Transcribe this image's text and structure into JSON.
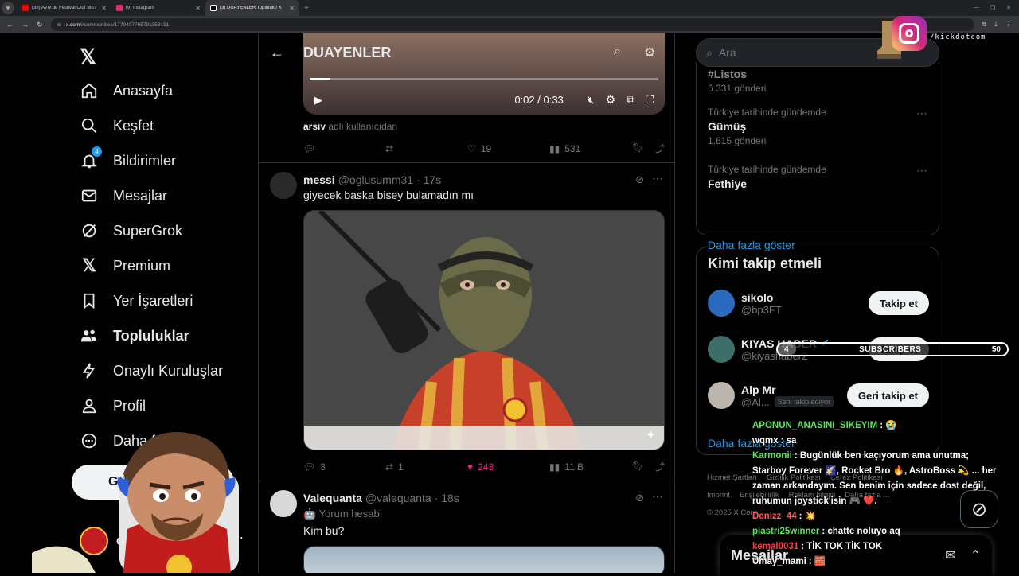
{
  "browser": {
    "tabs": [
      {
        "label": "(38) AVM'de Festival Olur Mu?",
        "color": "#ff0000"
      },
      {
        "label": "(9) Instagram",
        "color": "#e1306c"
      },
      {
        "label": "(3) DUAYENLER Topluluk / X",
        "color": "#ffffff"
      }
    ],
    "url_host": "x.com",
    "url_path": "/i/communities/1770407765791359191"
  },
  "sidebar": {
    "items": [
      {
        "label": "Anasayfa",
        "icon": "home-icon"
      },
      {
        "label": "Keşfet",
        "icon": "search-icon"
      },
      {
        "label": "Bildirimler",
        "icon": "bell-icon",
        "badge": "4"
      },
      {
        "label": "Mesajlar",
        "icon": "mail-icon"
      },
      {
        "label": "SuperGrok",
        "icon": "grok-icon"
      },
      {
        "label": "Premium",
        "icon": "x-icon"
      },
      {
        "label": "Yer İşaretleri",
        "icon": "bookmark-icon"
      },
      {
        "label": "Topluluklar",
        "icon": "communities-icon"
      },
      {
        "label": "Onaylı Kuruluşlar",
        "icon": "lightning-icon"
      },
      {
        "label": "Profil",
        "icon": "person-icon"
      },
      {
        "label": "Daha fazla",
        "icon": "more-circle-icon"
      }
    ],
    "post_label": "Gönderi yayınla",
    "account_name": "Câ"
  },
  "header": {
    "title": "DUAYENLER"
  },
  "video": {
    "time": "0:02 / 0:33",
    "progress": 0.06
  },
  "tweet0": {
    "attrib_user": "arsiv",
    "attrib_rest": " adlı kullanıcıdan",
    "replies": "",
    "retweets": "",
    "likes": "19",
    "views": "531"
  },
  "tweet1": {
    "name": "messi",
    "handle": "@oglusumm31",
    "time": "· 17s",
    "text": "giyecek baska bisey bulamadın mı",
    "replies": "3",
    "retweets": "1",
    "likes": "243",
    "views": "11 B"
  },
  "tweet2": {
    "name": "Valequanta",
    "handle": "@valequanta",
    "time": "· 18s",
    "sub": "🤖 Yorum hesabı",
    "text": "Kim bu?"
  },
  "right": {
    "search_placeholder": "Ara",
    "trends": [
      {
        "meta": "",
        "name": "#Listos",
        "count": "6.331 gönderi"
      },
      {
        "meta": "Türkiye tarihinde gündemde",
        "name": "Gümüş",
        "count": "1.615 gönderi"
      },
      {
        "meta": "Türkiye tarihinde gündemde",
        "name": "Fethiye",
        "count": ""
      }
    ],
    "show_more": "Daha fazla göster",
    "wtf_title": "Kimi takip etmeli",
    "wtf": [
      {
        "name": "sikolo",
        "handle": "@bp3FT",
        "button": "Takip et",
        "tag": "",
        "verified": false,
        "color": "#2a6bbf"
      },
      {
        "name": "KIYAS HABER",
        "handle": "@kiyashaber2",
        "button": "Takip et",
        "tag": "",
        "verified": true,
        "color": "#3d6e6a"
      },
      {
        "name": "Alp Mr",
        "handle": "@Al...",
        "button": "Geri takip et",
        "tag": "Seni takip ediyor",
        "verified": false,
        "color": "#bcb5ad"
      }
    ],
    "wtf_more": "Daha fazla göster",
    "footer": [
      "Hizmet Şartları",
      "Gizlilik Politikası",
      "Çerez Politikası",
      "Imprint",
      "Erişilebilirlik",
      "Reklam bilgisi",
      "Daha fazla ...",
      "© 2025 X Corp."
    ],
    "messages_title": "Mesajlar"
  },
  "overlay": {
    "ig_handle": "/kickdotcom",
    "sub_current": "4",
    "sub_label": "SUBSCRIBERS",
    "sub_goal": "50",
    "sub_progress": 0.08,
    "chat": [
      {
        "user": "APONUN_ANASINI_SIKEYIM",
        "color": "#5ee35e",
        "msg": ": 😭"
      },
      {
        "user": "wqmx",
        "color": "#ffffff",
        "msg": ": sa"
      },
      {
        "user": "Karmonii",
        "color": "#5ee35e",
        "msg": ": Bugünlük ben kaçıyorum ama unutma; Starboy Forever 🌠, Rocket Bro 🔥, AstroBoss 💫 ... her zaman arkandayım. Sen benim için sadece dost değil, ruhumun joystick'isin 🎮 ❤️."
      },
      {
        "user": "Denizz_44",
        "color": "#ff5c5c",
        "msg": ": 💥"
      },
      {
        "user": "piastri25winner",
        "color": "#5ee35e",
        "msg": ": chatte noluyo aq"
      },
      {
        "user": "kemal0031",
        "color": "#ff3c3c",
        "msg": ": TİK TOK TİK TOK"
      },
      {
        "user": "Umay_mami",
        "color": "#ffffff",
        "msg": ": 🧱"
      }
    ]
  },
  "colors": {
    "accent": "#1d9bf0",
    "like": "#f91880",
    "bg": "#000000",
    "muted": "#71767b"
  }
}
